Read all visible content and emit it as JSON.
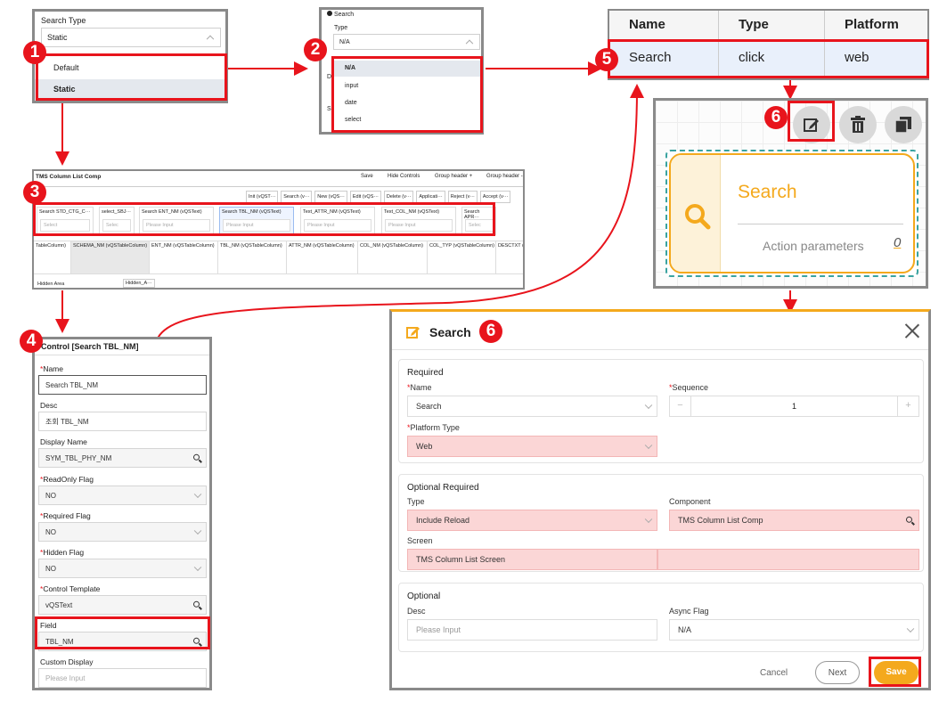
{
  "badges": {
    "b1": "1",
    "b2": "2",
    "b3": "3",
    "b4": "4",
    "b5": "5",
    "b6a": "6",
    "b6b": "6"
  },
  "panel1": {
    "label": "Search Type",
    "value": "Static",
    "options": [
      "Default",
      "Static"
    ]
  },
  "panel2": {
    "radio_label": "Search",
    "type_label": "Type",
    "value": "N/A",
    "options": [
      "N/A",
      "input",
      "date",
      "select"
    ],
    "frag_d": "D",
    "frag_s": "S"
  },
  "panel3": {
    "title": "TMS Column List Comp",
    "top_links": [
      "Save",
      "Hide Controls",
      "Group header +",
      "Group header -"
    ],
    "buttons": [
      "Init (vQST···",
      "Search (v···",
      "New (vQS···",
      "Edit (vQS···",
      "Delete (v···",
      "Applicati···",
      "Reject (v···",
      "Accept (v···"
    ],
    "filters": [
      {
        "label": "Search STD_CTG_C···",
        "value": "Select"
      },
      {
        "label": "select_SBJ···",
        "value": "Selec"
      },
      {
        "label": "Search ENT_NM (vQSText)",
        "value": "Please Input"
      },
      {
        "label": "Search TBL_NM (vQSText)",
        "value": "Please Input"
      },
      {
        "label": "Text_ATTR_NM (vQSText)",
        "value": "Please Input"
      },
      {
        "label": "Text_COL_NM (vQSText)",
        "value": "Please Input"
      },
      {
        "label": "Search APR···",
        "value": "Selec"
      }
    ],
    "columns": [
      "TableColumn)",
      "SCHEMA_NM (vQSTableColumn)",
      "ENT_NM (vQSTableColumn)",
      "TBL_NM (vQSTableColumn)",
      "ATTR_NM (vQSTableColumn)",
      "COL_NM (vQSTableColumn)",
      "COL_TYP (vQSTableColumn)",
      "DESCTXT ("
    ],
    "hidden_area": "Hidden Area",
    "hidden_a": "Hidden_A···"
  },
  "panel4": {
    "title": "Control [Search TBL_NM]",
    "fields": [
      {
        "label": "Name",
        "required": true,
        "value": "Search TBL_NM"
      },
      {
        "label": "Desc",
        "required": false,
        "value": "조회 TBL_NM"
      },
      {
        "label": "Display Name",
        "required": false,
        "value": "SYM_TBL_PHY_NM"
      },
      {
        "label": "ReadOnly Flag",
        "required": true,
        "value": "NO"
      },
      {
        "label": "Required Flag",
        "required": true,
        "value": "NO"
      },
      {
        "label": "Hidden Flag",
        "required": true,
        "value": "NO"
      },
      {
        "label": "Control Template",
        "required": true,
        "value": "vQSText"
      },
      {
        "label": "Field",
        "required": false,
        "value": "TBL_NM"
      },
      {
        "label": "Custom Display",
        "required": false,
        "value": "Please Input"
      }
    ],
    "req_mark": "*"
  },
  "panel5": {
    "headers": [
      "Name",
      "Type",
      "Platform"
    ],
    "row": [
      "Search",
      "click",
      "web"
    ]
  },
  "panel6": {
    "title": "Search",
    "subtitle": "Action parameters",
    "count": "0",
    "icons": [
      "edit-icon",
      "trash-icon",
      "copy-icon"
    ]
  },
  "dialog": {
    "title": "Search",
    "req_mark": "*",
    "required": {
      "heading": "Required",
      "name_label": "Name",
      "name_value": "Search",
      "seq_label": "Sequence",
      "seq_value": "1",
      "seq_minus": "−",
      "seq_plus": "+",
      "ptype_label": "Platform Type",
      "ptype_value": "Web"
    },
    "optional_required": {
      "heading": "Optional Required",
      "type_label": "Type",
      "type_value": "Include Reload",
      "component_label": "Component",
      "component_value": "TMS Column List Comp",
      "screen_label": "Screen",
      "screen_value": "TMS Column List Screen"
    },
    "optional": {
      "heading": "Optional",
      "desc_label": "Desc",
      "desc_placeholder": "Please Input",
      "async_label": "Async Flag",
      "async_value": "N/A"
    },
    "buttons": {
      "cancel": "Cancel",
      "next": "Next",
      "save": "Save"
    },
    "accent": "#f4a91d"
  }
}
